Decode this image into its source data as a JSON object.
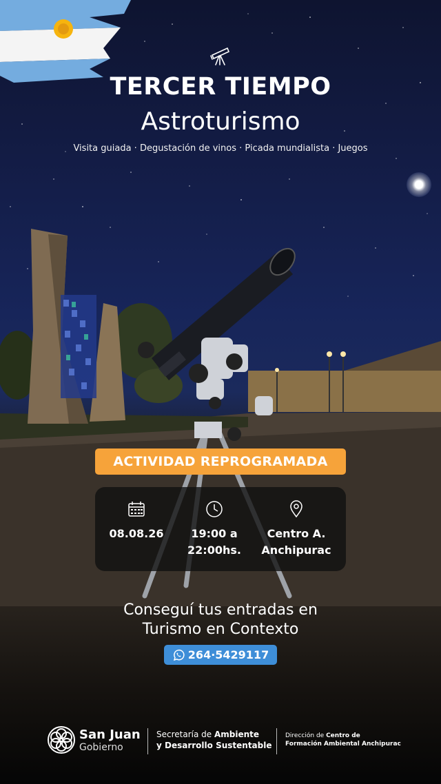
{
  "header": {
    "title": "TERCER TIEMPO",
    "subtitle": "Astroturismo",
    "activities": "Visita guiada · Degustación de vinos · Picada mundialista · Juegos"
  },
  "badge": {
    "label": "ACTIVIDAD REPROGRAMADA",
    "color": "#f6a33a"
  },
  "event": {
    "date": "08.08.26",
    "time_line1": "19:00 a",
    "time_line2": "22:00hs.",
    "place_line1": "Centro A.",
    "place_line2": "Anchipurac"
  },
  "cta": {
    "line1": "Conseguí tus entradas en",
    "line2": "Turismo en Contexto"
  },
  "phone": {
    "number": "264·5429117",
    "color": "#3e8ed8"
  },
  "footer": {
    "brand": "San Juan",
    "brand_sub": "Gobierno",
    "secretaria_prefix": "Secretaría de ",
    "secretaria_bold1": "Ambiente",
    "secretaria_bold2": "y Desarrollo Sustentable",
    "direccion_prefix": "Dirección de ",
    "direccion_bold1": "Centro de",
    "direccion_bold2": "Formación Ambiental Anchipurac"
  },
  "icons": [
    "telescope-icon",
    "calendar-icon",
    "clock-icon",
    "location-pin-icon",
    "whatsapp-icon",
    "san-juan-logo-icon"
  ]
}
